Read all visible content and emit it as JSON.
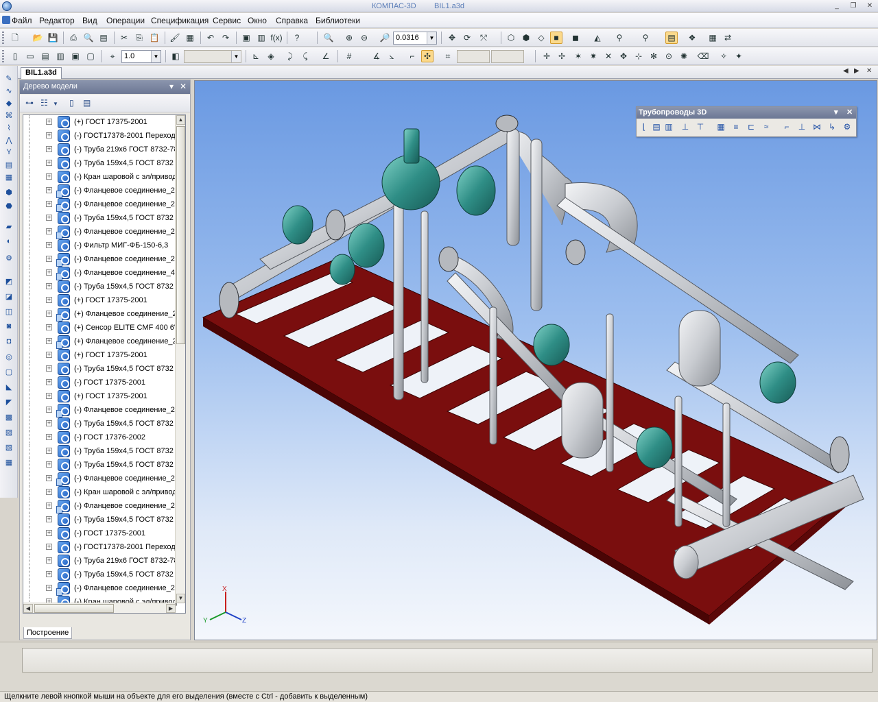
{
  "titlebar": {
    "app": "КОМПАС-3D",
    "document": "BIL1.a3d",
    "minimize": "_",
    "restore": "❐",
    "close": "✕"
  },
  "menu": [
    "Файл",
    "Редактор",
    "Вид",
    "Операции",
    "Спецификация",
    "Сервис",
    "Окно",
    "Справка",
    "Библиотеки"
  ],
  "toolbar": {
    "zoom_value": "0.0316",
    "step_value": "1.0"
  },
  "doc_tab": {
    "label": "BIL1.a3d"
  },
  "tree": {
    "title": "Дерево модели",
    "pin": "▾",
    "close": "✕",
    "bottom_tab": "Построение",
    "items": [
      {
        "label": "(+) ГОСТ 17375-2001",
        "group": false
      },
      {
        "label": "(-) ГОСТ17378-2001 Переход",
        "group": false
      },
      {
        "label": "(-) Труба 219x6 ГОСТ 8732-78",
        "group": false
      },
      {
        "label": "(-) Труба 159x4,5 ГОСТ 8732",
        "group": false
      },
      {
        "label": "(-) Кран шаровой с эл/привод",
        "group": false
      },
      {
        "label": "(-) Фланцевое соединение_2",
        "group": true
      },
      {
        "label": "(-) Фланцевое соединение_2",
        "group": true
      },
      {
        "label": "(-) Труба 159x4,5 ГОСТ 8732",
        "group": false
      },
      {
        "label": "(-) Фланцевое соединение_2",
        "group": true
      },
      {
        "label": "(-) Фильтр МИГ-ФБ-150-6,3",
        "group": false
      },
      {
        "label": "(-) Фланцевое соединение_2",
        "group": true
      },
      {
        "label": "(-) Фланцевое соединение_4",
        "group": true
      },
      {
        "label": "(-) Труба 159x4,5 ГОСТ 8732",
        "group": false
      },
      {
        "label": "(+) ГОСТ 17375-2001",
        "group": false
      },
      {
        "label": "(+) Фланцевое соединение_2",
        "group": true
      },
      {
        "label": "(+) Сенсор ELITE CMF 400 6\"",
        "group": false
      },
      {
        "label": "(+) Фланцевое соединение_2",
        "group": true
      },
      {
        "label": "(+) ГОСТ 17375-2001",
        "group": false
      },
      {
        "label": "(-) Труба 159x4,5 ГОСТ 8732",
        "group": false
      },
      {
        "label": "(-) ГОСТ 17375-2001",
        "group": false
      },
      {
        "label": "(+) ГОСТ 17375-2001",
        "group": false
      },
      {
        "label": "(-) Фланцевое соединение_2",
        "group": true
      },
      {
        "label": "(-) Труба 159x4,5 ГОСТ 8732",
        "group": false
      },
      {
        "label": "(-) ГОСТ 17376-2002",
        "group": false
      },
      {
        "label": "(-) Труба 159x4,5 ГОСТ 8732",
        "group": false
      },
      {
        "label": "(-) Труба 159x4,5 ГОСТ 8732",
        "group": false
      },
      {
        "label": "(-) Фланцевое соединение_2",
        "group": true
      },
      {
        "label": "(-) Кран шаровой с эл/привод",
        "group": false
      },
      {
        "label": "(-) Фланцевое соединение_2",
        "group": true
      },
      {
        "label": "(-) Труба 159x4,5 ГОСТ 8732",
        "group": false
      },
      {
        "label": "(-) ГОСТ 17375-2001",
        "group": false
      },
      {
        "label": "(-) ГОСТ17378-2001 Переход",
        "group": false
      },
      {
        "label": "(-) Труба 219x6 ГОСТ 8732-78",
        "group": false
      },
      {
        "label": "(-) Труба 159x4,5 ГОСТ 8732",
        "group": false
      },
      {
        "label": "(-) Фланцевое соединение_2",
        "group": true
      },
      {
        "label": "(-) Кран шаровой с эл/привод",
        "group": false
      }
    ]
  },
  "pipelines_panel": {
    "title": "Трубопроводы 3D",
    "menu": "▾",
    "close": "✕"
  },
  "axes": {
    "x": "X",
    "y": "Y",
    "z": "Z"
  },
  "status": "Щелкните левой кнопкой мыши на объекте для его выделения (вместе с Ctrl - добавить к выделенным)",
  "colors": {
    "frame": "#7a0e0e",
    "frame_dark": "#4a0505",
    "pipe": "#d3d5d8",
    "valve": "#3a9e94",
    "sky_top": "#6a99e2"
  }
}
